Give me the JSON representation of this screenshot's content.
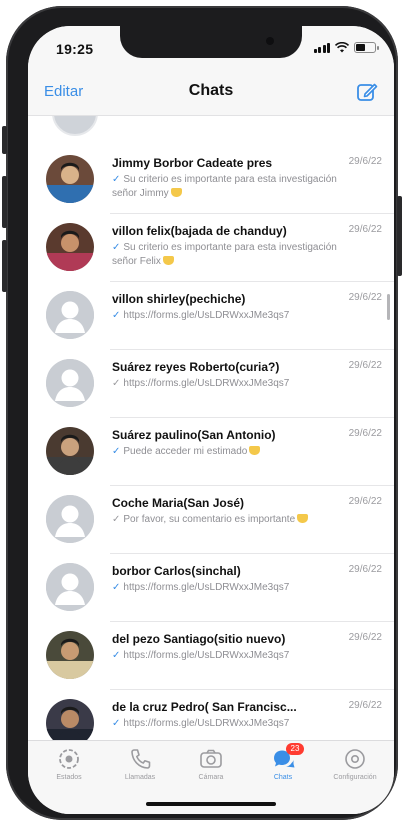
{
  "status_bar": {
    "time": "19:25"
  },
  "nav": {
    "left_label": "Editar",
    "title": "Chats",
    "compose_icon": "compose-icon"
  },
  "chats": [
    {
      "name": "Jimmy Borbor Cadeate pres",
      "date": "29/6/22",
      "check": "✓",
      "check_color": "blue",
      "preview": "Su criterio es importante para esta investigación señor Jimmy",
      "emoji": true,
      "avatar": "photo"
    },
    {
      "name": "villon felix(bajada de chanduy)",
      "date": "29/6/22",
      "check": "✓",
      "check_color": "blue",
      "preview": "Su criterio es importante para esta investigación señor Felix",
      "emoji": true,
      "avatar": "photo"
    },
    {
      "name": "villon shirley(pechiche)",
      "date": "29/6/22",
      "check": "✓",
      "check_color": "blue",
      "preview": "https://forms.gle/UsLDRWxxJMe3qs7",
      "emoji": false,
      "avatar": "default"
    },
    {
      "name": "Suárez reyes Roberto(curia?)",
      "date": "29/6/22",
      "check": "✓",
      "check_color": "grey",
      "preview": "https://forms.gle/UsLDRWxxJMe3qs7",
      "emoji": false,
      "avatar": "default"
    },
    {
      "name": "Suárez paulino(San Antonio)",
      "date": "29/6/22",
      "check": "✓",
      "check_color": "blue",
      "preview": "Puede acceder mi estimado",
      "emoji": true,
      "avatar": "photo"
    },
    {
      "name": "Coche Maria(San José)",
      "date": "29/6/22",
      "check": "✓",
      "check_color": "grey",
      "preview": "Por favor, su comentario es importante",
      "emoji": true,
      "avatar": "default"
    },
    {
      "name": "borbor Carlos(sinchal)",
      "date": "29/6/22",
      "check": "✓",
      "check_color": "blue",
      "preview": "https://forms.gle/UsLDRWxxJMe3qs7",
      "emoji": false,
      "avatar": "default"
    },
    {
      "name": "del pezo Santiago(sitio nuevo)",
      "date": "29/6/22",
      "check": "✓",
      "check_color": "blue",
      "preview": "https://forms.gle/UsLDRWxxJMe3qs7",
      "emoji": false,
      "avatar": "photo"
    },
    {
      "name": "de la cruz Pedro( San Francisc...",
      "date": "29/6/22",
      "check": "✓",
      "check_color": "blue",
      "preview": "https://forms.gle/UsLDRWxxJMe3qs7",
      "emoji": false,
      "avatar": "photo"
    }
  ],
  "tabs": [
    {
      "label": "Estados",
      "icon": "status-icon",
      "active": false
    },
    {
      "label": "Llamadas",
      "icon": "phone-icon",
      "active": false
    },
    {
      "label": "Cámara",
      "icon": "camera-icon",
      "active": false
    },
    {
      "label": "Chats",
      "icon": "chats-icon",
      "active": true,
      "badge": "23"
    },
    {
      "label": "Configuración",
      "icon": "settings-icon",
      "active": false
    }
  ],
  "colors": {
    "accent": "#3a8ee6",
    "badge": "#ff3b30",
    "frame": "#1c1c1e"
  }
}
